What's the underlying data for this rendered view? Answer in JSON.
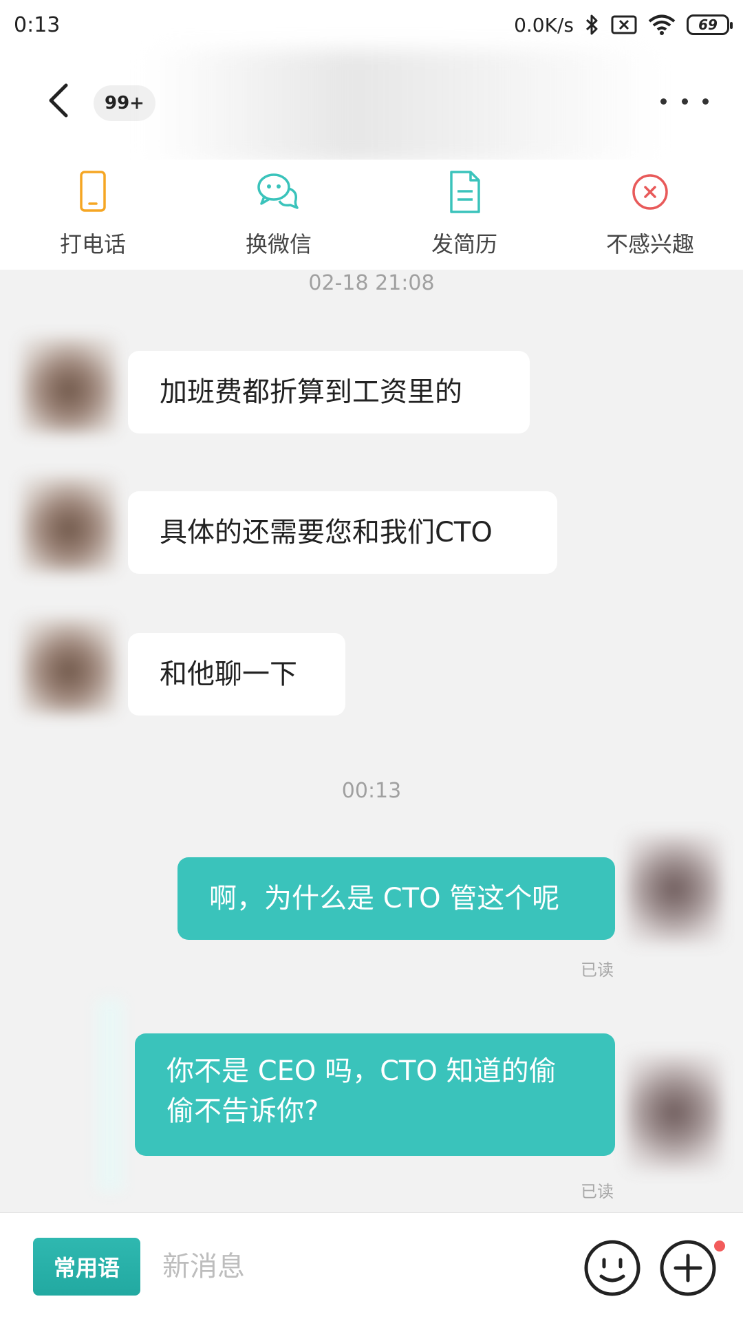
{
  "status_bar": {
    "time": "0:13",
    "net_speed": "0.0K/s",
    "battery": "69"
  },
  "header": {
    "unread_count": "99+"
  },
  "actions": [
    {
      "label": "打电话",
      "icon": "phone-icon",
      "color": "#f5a623"
    },
    {
      "label": "换微信",
      "icon": "wechat-icon",
      "color": "#3ac3bb"
    },
    {
      "label": "发简历",
      "icon": "resume-icon",
      "color": "#3ac3bb"
    },
    {
      "label": "不感兴趣",
      "icon": "not-interested-icon",
      "color": "#e85a5a"
    }
  ],
  "chat": {
    "timestamp_1": "02-18 21:08",
    "incoming": [
      "加班费都折算到工资里的",
      "具体的还需要您和我们CTO",
      "和他聊一下"
    ],
    "timestamp_2": "00:13",
    "outgoing": [
      {
        "text": "啊，为什么是 CTO 管这个呢",
        "status": "已读"
      },
      {
        "text_line1": "你不是 CEO 吗，CTO 知道的偷",
        "text_line2": "偷不告诉你?",
        "status": "已读"
      }
    ]
  },
  "bottom_bar": {
    "phrases_label": "常用语",
    "input_placeholder": "新消息"
  },
  "colors": {
    "accent": "#3ac3bb",
    "background": "#f2f2f2"
  }
}
